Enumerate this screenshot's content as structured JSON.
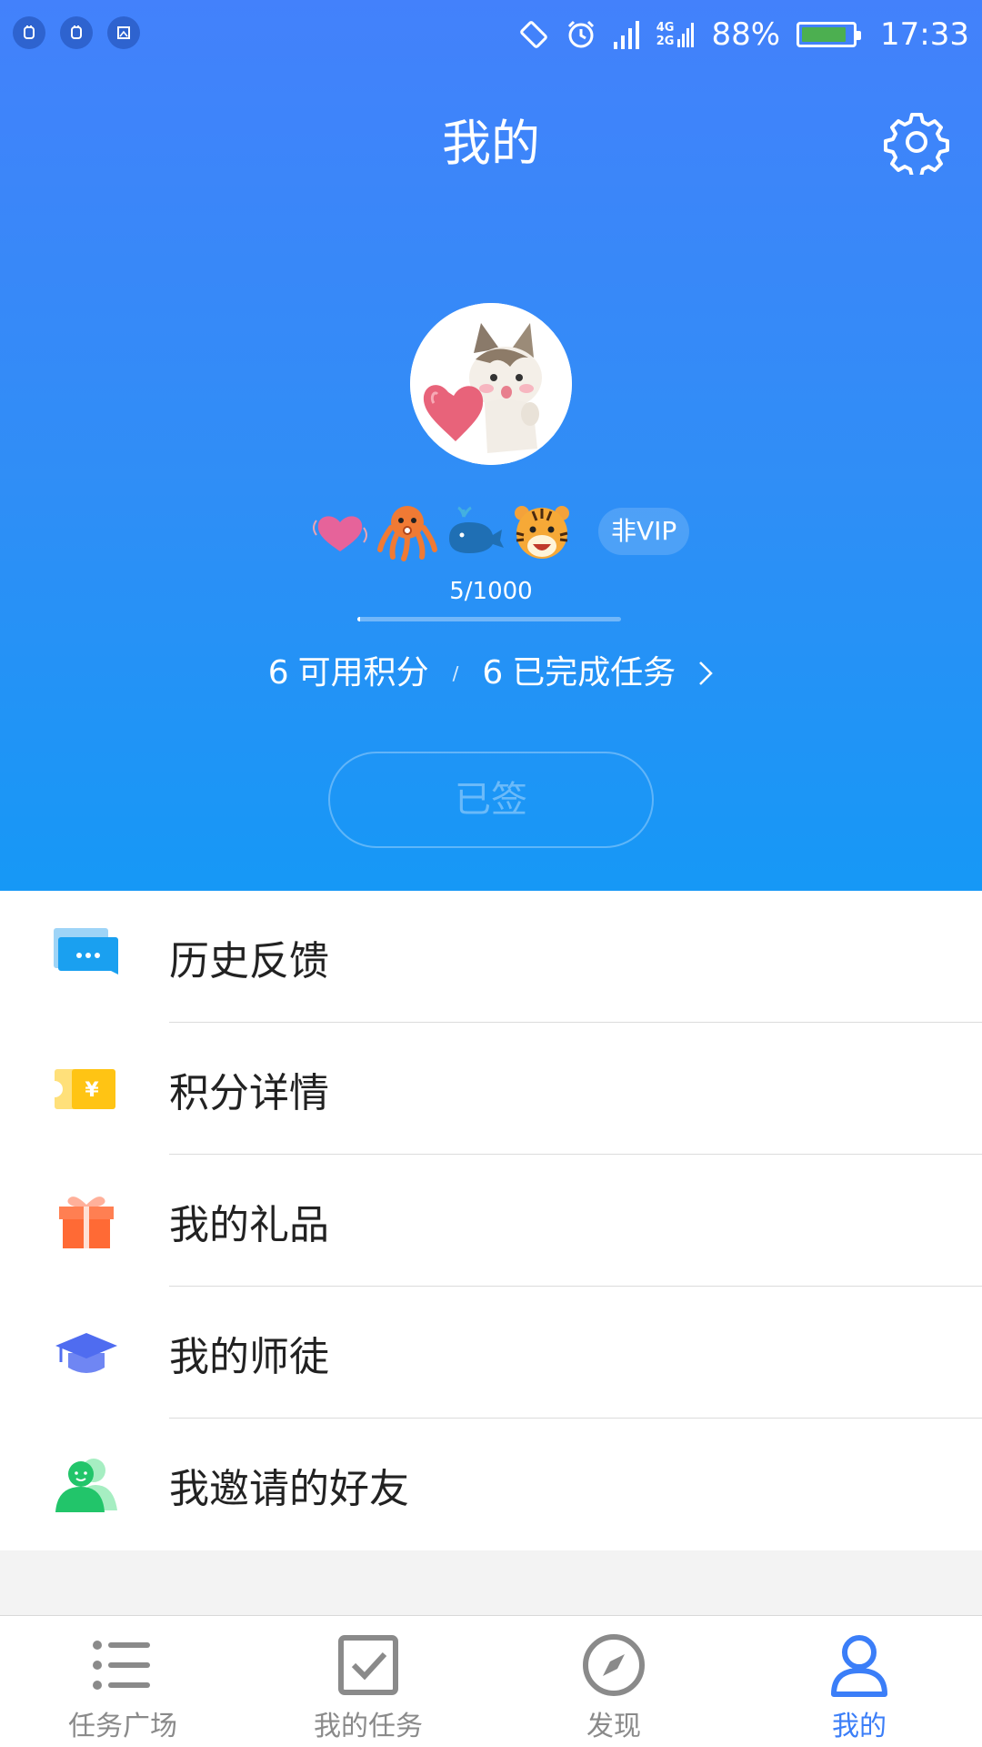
{
  "status_bar": {
    "battery_percent": "88%",
    "battery_level": 0.88,
    "time": "17:33",
    "network_top": "4G",
    "network_bottom": "2G",
    "icons": [
      "notification-icon",
      "notification-icon",
      "screenshot-icon",
      "rotate-icon",
      "alarm-icon",
      "signal-icon",
      "network-icon",
      "battery-icon"
    ]
  },
  "header": {
    "title": "我的",
    "settings_icon": "gear-icon"
  },
  "profile": {
    "avatar": "cat-with-heart-avatar",
    "badges": [
      "heart-badge",
      "octopus-badge",
      "whale-badge",
      "tiger-badge"
    ],
    "vip_label": "非VIP",
    "progress_text": "5/1000",
    "progress_fraction": 0.005,
    "points_value": "6",
    "points_label": "可用积分",
    "separator": "/",
    "tasks_value": "6",
    "tasks_label": "已完成任务",
    "signed_label": "已签"
  },
  "menu": {
    "items": [
      {
        "label": "历史反馈",
        "icon": "chat-bubble-icon"
      },
      {
        "label": "积分详情",
        "icon": "ticket-yen-icon"
      },
      {
        "label": "我的礼品",
        "icon": "gift-icon"
      },
      {
        "label": "我的师徒",
        "icon": "graduation-cap-icon"
      },
      {
        "label": "我邀请的好友",
        "icon": "friends-icon"
      }
    ]
  },
  "bottom_nav": {
    "items": [
      {
        "label": "任务广场",
        "icon": "list-icon"
      },
      {
        "label": "我的任务",
        "icon": "checkbox-icon"
      },
      {
        "label": "发现",
        "icon": "compass-icon"
      },
      {
        "label": "我的",
        "icon": "person-icon"
      }
    ],
    "active_index": 3
  },
  "colors": {
    "header_top": "#4381fb",
    "header_bottom": "#1698f6",
    "accent": "#3b7ef8",
    "inactive": "#8a8a8a"
  }
}
